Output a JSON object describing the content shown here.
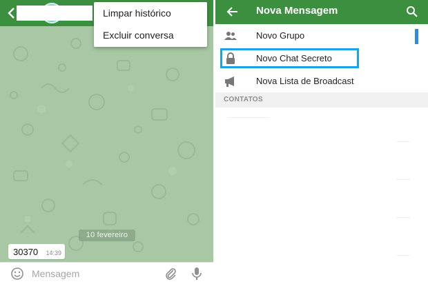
{
  "left_panel": {
    "menu": {
      "items": [
        "Limpar histórico",
        "Excluir conversa"
      ]
    },
    "date_chip": "10 fevereiro",
    "message": {
      "text": "30370",
      "time": "14:39"
    },
    "input_placeholder": "Mensagem",
    "icons": {
      "back": "chevron-left-icon",
      "emoji": "smiley-icon",
      "attach": "paperclip-icon",
      "mic": "microphone-icon"
    }
  },
  "right_panel": {
    "title": "Nova Mensagem",
    "items": [
      {
        "label": "Novo Grupo",
        "icon": "group-icon"
      },
      {
        "label": "Novo Chat Secreto",
        "icon": "lock-icon"
      },
      {
        "label": "Nova Lista de Broadcast",
        "icon": "megaphone-icon"
      }
    ],
    "section_header": "CONTATOS",
    "icons": {
      "back": "arrow-left-icon",
      "search": "search-icon"
    }
  },
  "colors": {
    "header_green": "#3d8f40",
    "chat_background": "#a8c7a4",
    "highlight_blue": "#1aa3e8",
    "scroll_blue": "#2d8cdc"
  }
}
